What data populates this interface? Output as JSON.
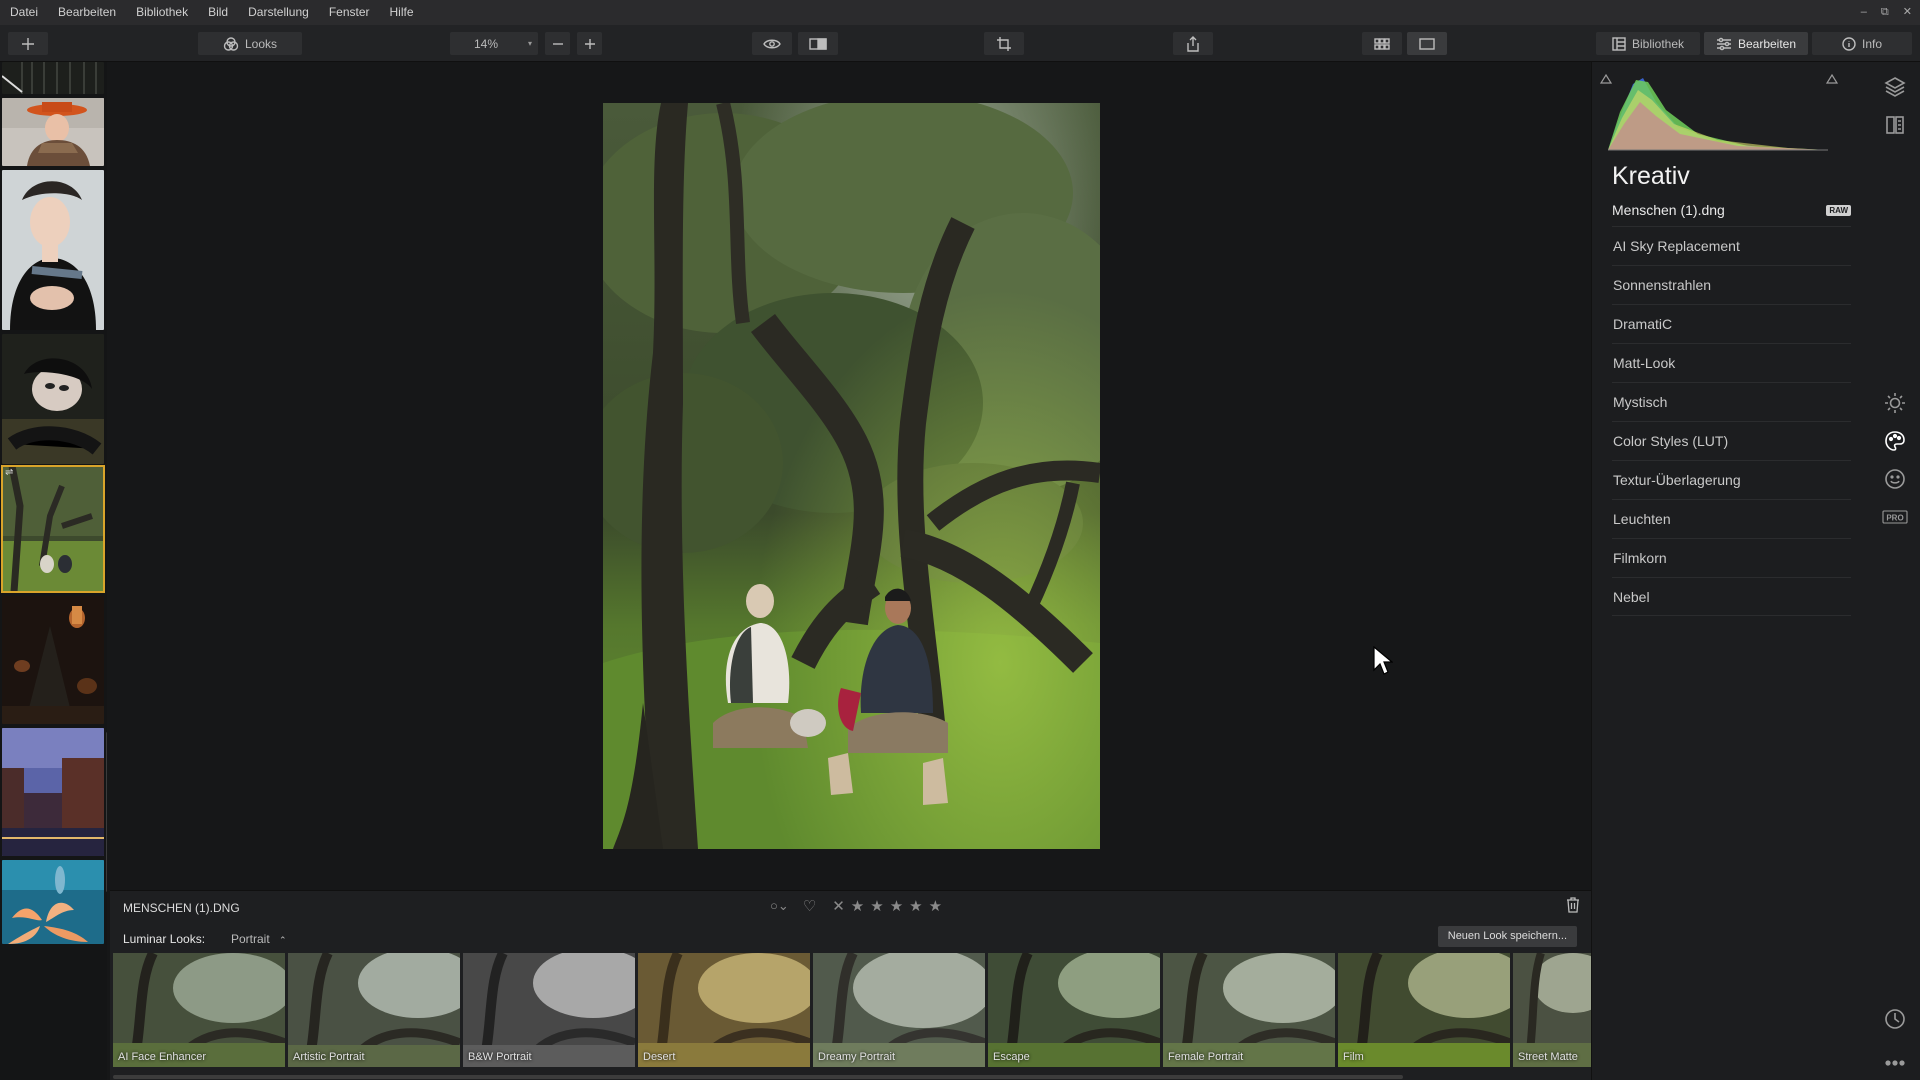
{
  "menu": [
    "Datei",
    "Bearbeiten",
    "Bibliothek",
    "Bild",
    "Darstellung",
    "Fenster",
    "Hilfe"
  ],
  "toolbar": {
    "looks_label": "Looks",
    "zoom": "14%",
    "tabs": {
      "library": "Bibliothek",
      "edit": "Bearbeiten",
      "info": "Info"
    }
  },
  "bottom": {
    "filename": "MENSCHEN (1).DNG",
    "looks_label": "Luminar Looks:",
    "category": "Portrait",
    "save_look": "Neuen Look speichern...",
    "looks": [
      "AI Face Enhancer",
      "Artistic Portrait",
      "B&W Portrait",
      "Desert",
      "Dreamy Portrait",
      "Escape",
      "Female Portrait",
      "Film",
      "Street Matte"
    ]
  },
  "panel": {
    "title": "Kreativ",
    "file": "Menschen (1).dng",
    "badge": "RAW",
    "tools": [
      "AI Sky Replacement",
      "Sonnenstrahlen",
      "DramatiC",
      "Matt-Look",
      "Mystisch",
      "Color Styles (LUT)",
      "Textur-Überlagerung",
      "Leuchten",
      "Filmkorn",
      "Nebel"
    ]
  },
  "rail_icons": [
    "layers-icon",
    "compare-panel-icon",
    "sun-icon",
    "palette-icon",
    "face-icon",
    "pro-icon",
    "history-icon",
    "more-icon"
  ],
  "colors": {
    "accent_selected": "#d9a42a",
    "panel_bg": "#1c1d1f",
    "canvas_bg": "#161718"
  }
}
